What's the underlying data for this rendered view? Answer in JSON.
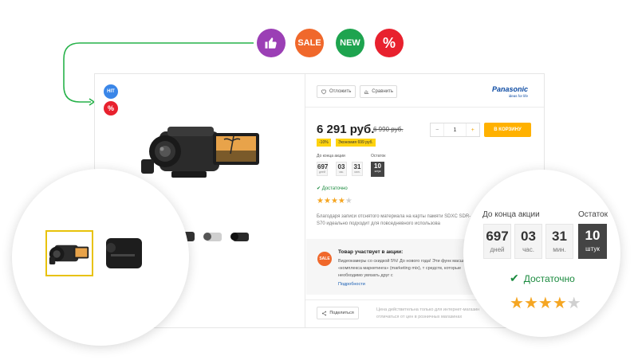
{
  "top_badges": [
    {
      "name": "like",
      "icon": "thumbs-up-icon",
      "color": "#9b3fb5"
    },
    {
      "name": "sale",
      "label": "SALE",
      "color": "#f0682b"
    },
    {
      "name": "new",
      "label": "NEW",
      "color": "#1ea44f"
    },
    {
      "name": "discount",
      "label": "%",
      "color": "#e8212e"
    }
  ],
  "card": {
    "mini_badges": {
      "hit": "HIT",
      "percent": "%"
    },
    "toolbar": {
      "defer_label": "Отложить",
      "compare_label": "Сравнить"
    },
    "brand": {
      "name": "Panasonic",
      "slogan": "ideas for life"
    },
    "price": "6 291 руб.",
    "old_price": "6 990 руб.",
    "discount_tag": "-10%",
    "savings_tag": "Экономия 699 руб.",
    "quantity": {
      "minus": "−",
      "value": "1",
      "plus": "+"
    },
    "cart_label": "В КОРЗИНУ",
    "timer": {
      "label": "До конца акции",
      "stock_label": "Остаток",
      "days": "697",
      "days_unit": "дней",
      "hours": "03",
      "hours_unit": "час.",
      "minutes": "31",
      "minutes_unit": "мин.",
      "stock": "10",
      "stock_unit": "штук"
    },
    "availability": "Достаточно",
    "rating": {
      "filled": 4,
      "total": 5
    },
    "description": "Благодаря записи отснятого материала на карты памяти SDXC SDR-S70 идеально подходит для повседневного использова",
    "promo": {
      "badge": "SALE",
      "title": "Товар участвует в акции:",
      "text": "Видеокамеры со скидкой 5%! До нового года! Эти функ масштабного «комплекса маркетинга» (marketing mix), т средств, которые необходимо увязать друг с",
      "link": "Подробности"
    },
    "share_label": "Поделиться",
    "price_note": "Цена действительна только для интернет-магазин отличаться от цен в розничных магазинах"
  },
  "magnifier_right": {
    "timer_label": "До конца акции",
    "stock_label": "Остаток",
    "days": "697",
    "days_unit": "дней",
    "hours": "03",
    "hours_unit": "час.",
    "minutes": "31",
    "minutes_unit": "мин.",
    "stock": "10",
    "stock_unit": "штук",
    "availability": "Достаточно",
    "rating": {
      "filled": 4,
      "total": 5
    }
  },
  "colors": {
    "accent": "#ffb100",
    "price_tag": "#ffd30e",
    "available": "#1a8a3e",
    "stars": "#f5a623",
    "thumb_border": "#e8c20a"
  }
}
